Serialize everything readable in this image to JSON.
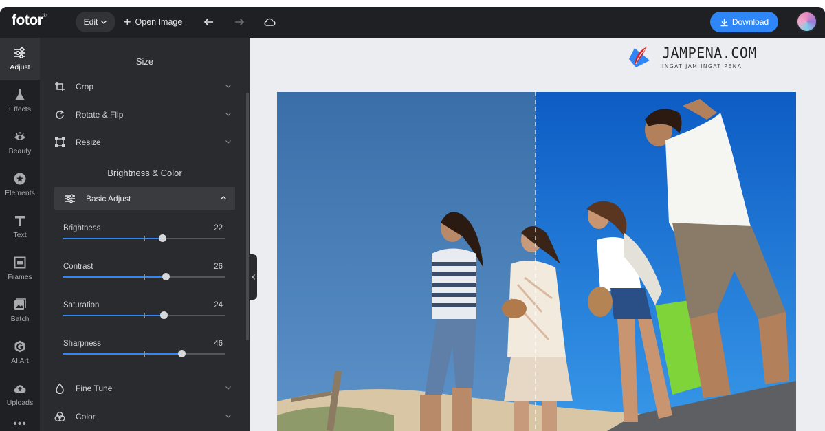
{
  "app": {
    "logo": "fotor",
    "logo_mark": "®"
  },
  "topbar": {
    "edit_label": "Edit",
    "open_image_label": "Open Image",
    "download_label": "Download"
  },
  "rail": {
    "items": [
      {
        "label": "Adjust",
        "icon": "sliders-icon"
      },
      {
        "label": "Effects",
        "icon": "flask-icon"
      },
      {
        "label": "Beauty",
        "icon": "eye-icon"
      },
      {
        "label": "Elements",
        "icon": "star-icon"
      },
      {
        "label": "Text",
        "icon": "text-icon"
      },
      {
        "label": "Frames",
        "icon": "frame-icon"
      },
      {
        "label": "Batch",
        "icon": "batch-icon"
      },
      {
        "label": "AI Art",
        "icon": "ai-art-icon"
      },
      {
        "label": "Uploads",
        "icon": "upload-cloud-icon"
      }
    ],
    "more": "•••"
  },
  "panel": {
    "size_title": "Size",
    "size_tools": [
      {
        "label": "Crop",
        "icon": "crop-icon"
      },
      {
        "label": "Rotate & Flip",
        "icon": "rotate-icon"
      },
      {
        "label": "Resize",
        "icon": "resize-icon"
      }
    ],
    "color_title": "Brightness & Color",
    "basic_adjust_label": "Basic Adjust",
    "sliders": [
      {
        "label": "Brightness",
        "value": 22
      },
      {
        "label": "Contrast",
        "value": 26
      },
      {
        "label": "Saturation",
        "value": 24
      },
      {
        "label": "Sharpness",
        "value": 46
      }
    ],
    "more_tools": [
      {
        "label": "Fine Tune",
        "icon": "droplet-icon"
      },
      {
        "label": "Color",
        "icon": "color-circles-icon"
      }
    ]
  },
  "watermark": {
    "title": "JAMPENA.COM",
    "tagline": "INGAT JAM INGAT PENA"
  },
  "colors": {
    "accent": "#2f86f7",
    "dark_bg": "#1f2023",
    "panel_bg": "#2a2b2e"
  }
}
